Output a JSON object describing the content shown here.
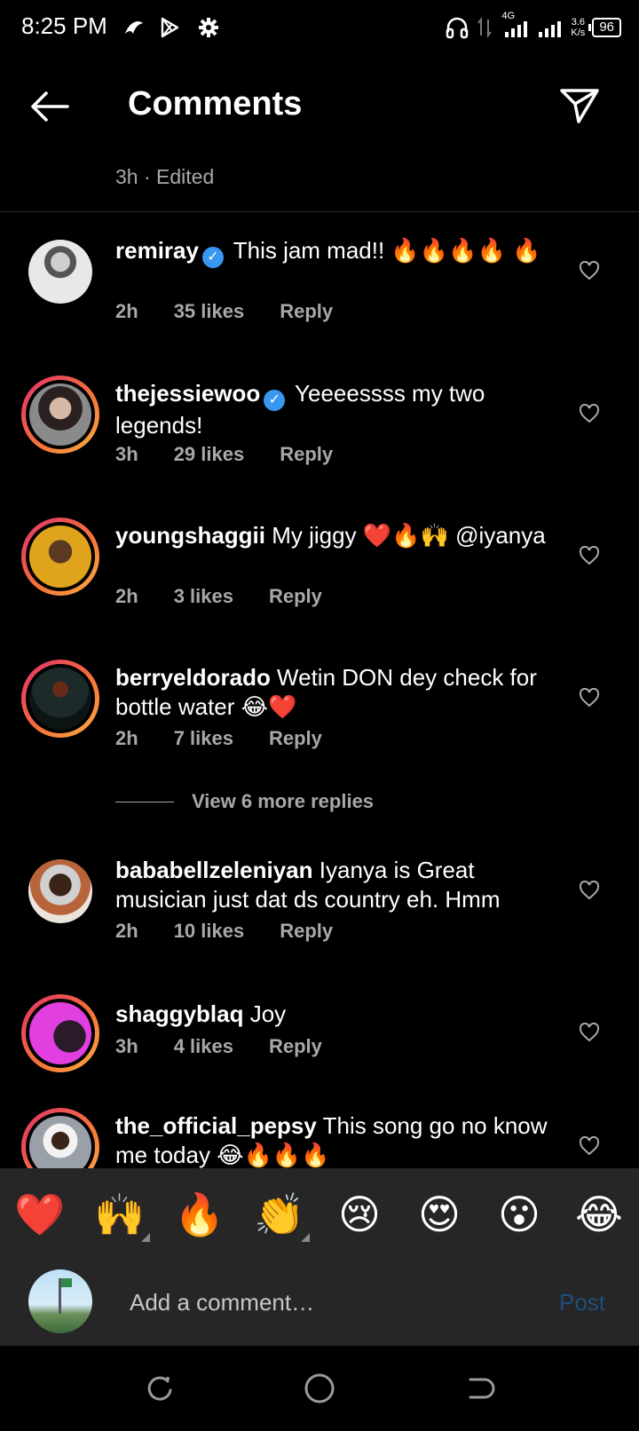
{
  "status_bar": {
    "time": "8:25 PM",
    "network": "4G",
    "speed_value": "3.6",
    "speed_unit": "K/s",
    "battery": "96"
  },
  "header": {
    "title": "Comments",
    "back_icon": "arrow-left-icon",
    "share_icon": "send-icon"
  },
  "subheader": {
    "text": "3h · Edited"
  },
  "comments": [
    {
      "username": "remiray",
      "verified": true,
      "text": " This jam mad!! 🔥🔥🔥🔥 🔥",
      "time": "2h",
      "likes": "35 likes",
      "reply": "Reply",
      "ring": false
    },
    {
      "username": "thejessiewoo",
      "verified": true,
      "text": " Yeeeessss my two legends!",
      "time": "3h",
      "likes": "29 likes",
      "reply": "Reply",
      "ring": true
    },
    {
      "username": "youngshaggii",
      "verified": false,
      "text": " My jiggy ❤️🔥🙌 @iyanya",
      "time": "2h",
      "likes": "3 likes",
      "reply": "Reply",
      "ring": true
    },
    {
      "username": "berryeldorado",
      "verified": false,
      "text": " Wetin DON dey check for bottle water 😂❤️",
      "time": "2h",
      "likes": "7 likes",
      "reply": "Reply",
      "ring": true
    },
    {
      "username": "bababellzeleniyan",
      "verified": false,
      "text": " Iyanya is Great musician just dat ds country eh. Hmm",
      "time": "2h",
      "likes": "10 likes",
      "reply": "Reply",
      "ring": false
    },
    {
      "username": "shaggyblaq",
      "verified": false,
      "text": " Joy",
      "time": "3h",
      "likes": "4 likes",
      "reply": "Reply",
      "ring": true
    },
    {
      "username": "the_official_pepsy",
      "verified": false,
      "text": " This song go no know me today 😂🔥🔥🔥",
      "time": "",
      "likes": "",
      "reply": "",
      "ring": true
    }
  ],
  "view_more_replies": "View 6 more replies",
  "emoji_bar": [
    "❤️",
    "🙌",
    "🔥",
    "👏",
    "😢",
    "😍",
    "😮",
    "😂"
  ],
  "composer": {
    "placeholder": "Add a comment…",
    "post_label": "Post"
  },
  "colors": {
    "background": "#000000",
    "secondary_text": "#a8a8a8",
    "verified": "#3897f0",
    "post_disabled": "#1e4f7a",
    "panel": "#262626"
  }
}
